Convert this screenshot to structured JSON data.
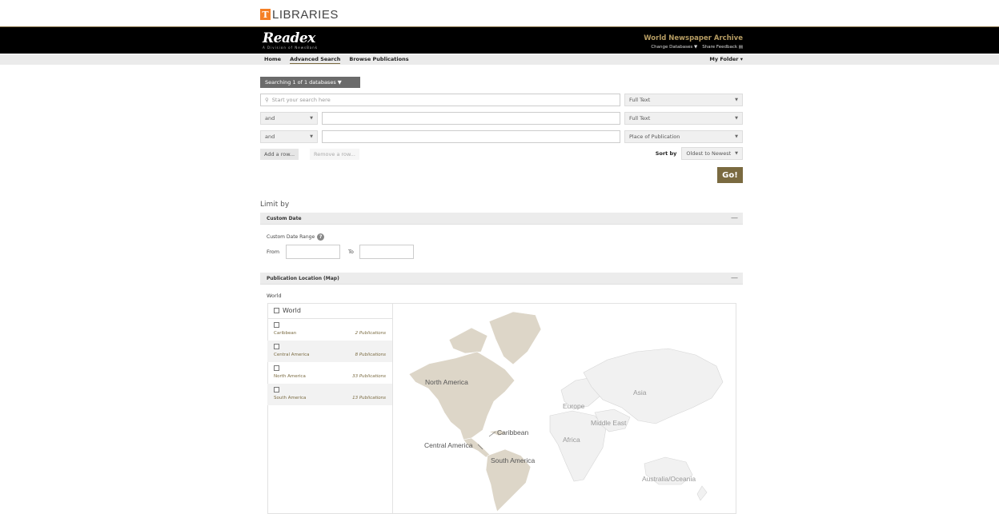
{
  "ut": {
    "mark": "T",
    "name": "LIBRARIES"
  },
  "brand": {
    "logo": "Readex",
    "tagline": "A Division of NewsBank",
    "product": "World Newspaper Archive",
    "change_db": "Change Databases ▼",
    "share": "Share Feedback"
  },
  "nav": {
    "home": "Home",
    "advanced": "Advanced Search",
    "browse": "Browse Publications",
    "folder": "My Folder ▾"
  },
  "search": {
    "db_button": "Searching 1 of 1 databases ▼",
    "row1_placeholder": "Start your search here",
    "row1_field": "Full Text",
    "row2_op": "and",
    "row2_field": "Full Text",
    "row3_op": "and",
    "row3_field": "Place of Publication",
    "add_row": "Add a row...",
    "remove_row": "Remove a row...",
    "sort_label": "Sort by",
    "sort_value": "Oldest to Newest",
    "go": "Go!"
  },
  "limit": {
    "title": "Limit by",
    "custom_date": "Custom Date",
    "custom_date_range": "Custom Date Range",
    "help": "?",
    "from": "From",
    "to": "To",
    "pub_location": "Publication Location (Map)",
    "breadcrumb": "World",
    "world_label": "World",
    "regions": [
      {
        "name": "Caribbean",
        "count": "2 Publications"
      },
      {
        "name": "Central America",
        "count": "8 Publications"
      },
      {
        "name": "North America",
        "count": "33 Publications"
      },
      {
        "name": "South America",
        "count": "13 Publications"
      }
    ]
  },
  "map": {
    "north_america": "North America",
    "caribbean": "Caribbean",
    "central_america": "Central America",
    "south_america": "South America",
    "europe": "Europe",
    "asia": "Asia",
    "middle_east": "Middle East",
    "africa": "Africa",
    "oceania": "Australia/Oceania"
  },
  "colors": {
    "accent": "#7a6a40",
    "topbar": "#000000",
    "product": "#b79d63",
    "ut_orange": "#f58025"
  }
}
